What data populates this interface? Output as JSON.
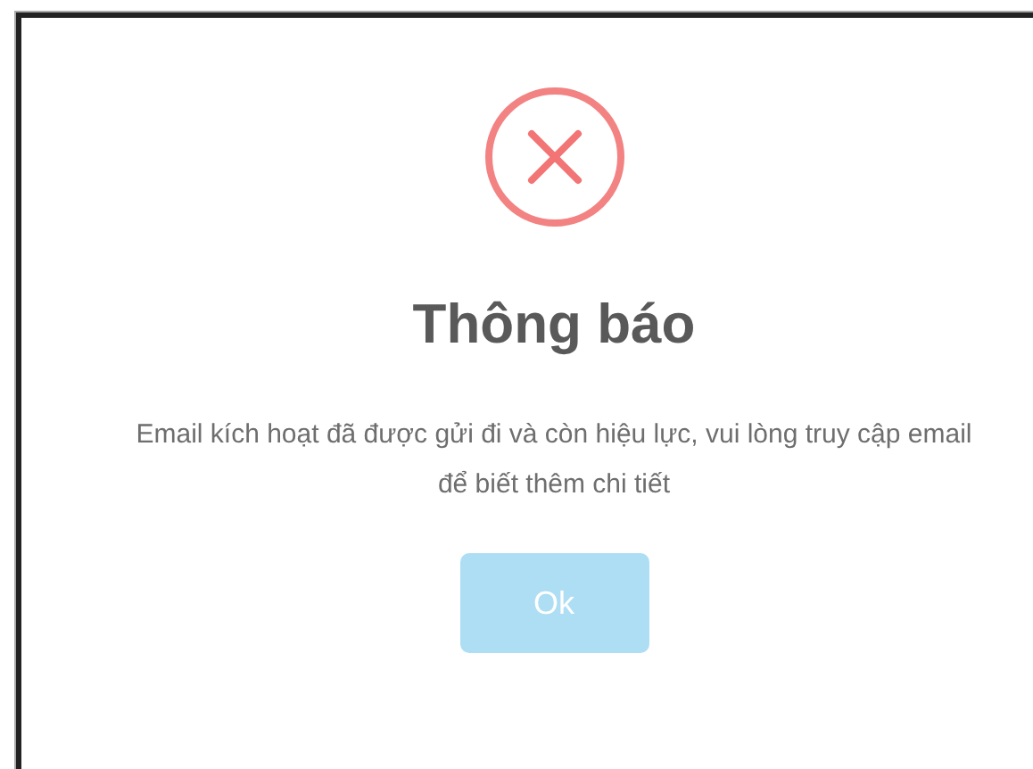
{
  "dialog": {
    "icon": {
      "kind": "error"
    },
    "title": "Thông báo",
    "message": "Email kích hoạt đã được gửi đi và còn hiệu lực, vui lòng truy cập email để biết thêm chi tiết",
    "button": {
      "label": "Ok",
      "disabled": true
    }
  }
}
